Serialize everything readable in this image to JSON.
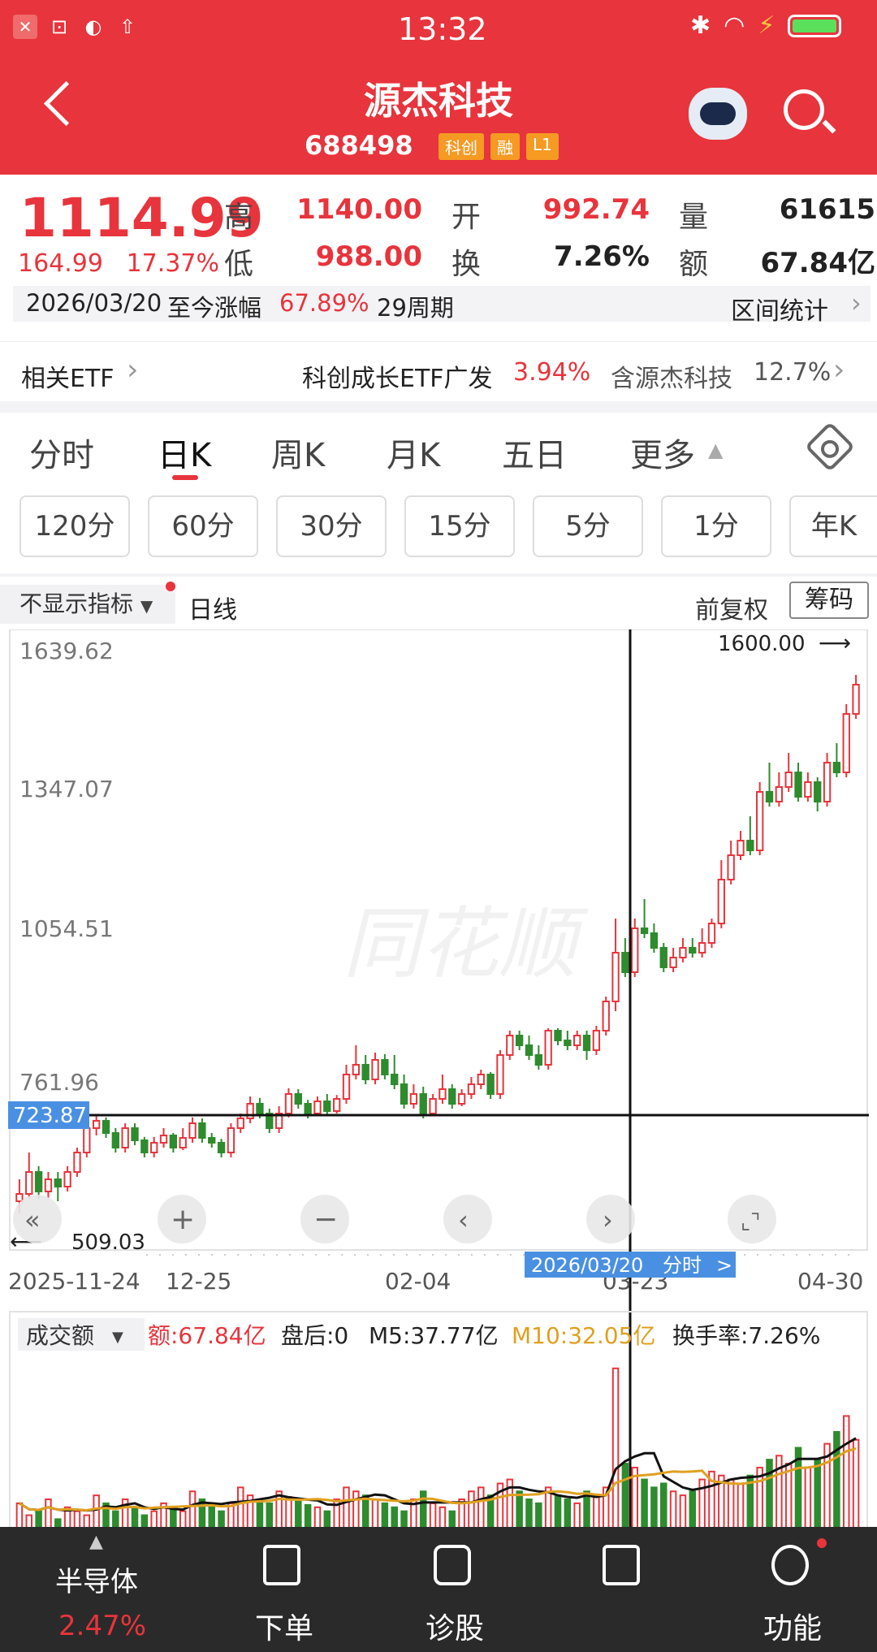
{
  "status_bar": {
    "time": "13:32"
  },
  "header": {
    "title": "源杰科技",
    "code": "688498",
    "tags": [
      "科创",
      "融",
      "L1"
    ]
  },
  "quote": {
    "price": "1114.99",
    "change": "164.99",
    "change_pct": "17.37%",
    "high_label": "高",
    "high": "1140.00",
    "low_label": "低",
    "low": "988.00",
    "open_label": "开",
    "open": "992.74",
    "turnover_label": "换",
    "turnover": "7.26%",
    "volume_label": "量",
    "volume": "61615",
    "amount_label": "额",
    "amount": "67.84亿"
  },
  "range_bar": {
    "date": "2026/03/20",
    "text": "至今涨幅",
    "pct": "67.89%",
    "periods": "29周期",
    "stats_label": "区间统计"
  },
  "etf": {
    "label": "相关ETF",
    "fund": "科创成长ETF广发",
    "fund_pct": "3.94%",
    "contains": "含源杰科技",
    "contains_pct": "12.7%"
  },
  "tabs": [
    "分时",
    "日K",
    "周K",
    "月K",
    "五日",
    "更多"
  ],
  "minute_buttons": [
    "120分",
    "60分",
    "30分",
    "15分",
    "5分",
    "1分",
    "年K"
  ],
  "chart_header": {
    "indicator": "不显示指标",
    "line_type": "日线",
    "adjust": "前复权",
    "chips": "筹码"
  },
  "chart_data": {
    "type": "candlestick",
    "y_ticks": [
      "1639.62",
      "1347.07",
      "1054.51",
      "761.96"
    ],
    "x_ticks": [
      "2025-11-24",
      "12-25",
      "02-04",
      "03-23",
      "04-30"
    ],
    "high_marker": "1600.00",
    "low_marker": "509.03",
    "crosshair_price": "723.87",
    "crosshair_date": "2026/03/20",
    "crosshair_tag": "分时",
    "ylim": [
      480,
      1680
    ],
    "candles": [
      [
        540,
        555,
        515,
        585
      ],
      [
        555,
        600,
        545,
        640
      ],
      [
        600,
        560,
        545,
        612
      ],
      [
        560,
        585,
        545,
        600
      ],
      [
        585,
        570,
        540,
        600
      ],
      [
        570,
        600,
        560,
        612
      ],
      [
        600,
        640,
        590,
        650
      ],
      [
        640,
        690,
        630,
        700
      ],
      [
        690,
        705,
        675,
        715
      ],
      [
        705,
        680,
        670,
        712
      ],
      [
        680,
        650,
        640,
        690
      ],
      [
        650,
        690,
        640,
        700
      ],
      [
        690,
        665,
        655,
        700
      ],
      [
        665,
        640,
        630,
        672
      ],
      [
        640,
        660,
        630,
        672
      ],
      [
        660,
        675,
        650,
        690
      ],
      [
        675,
        650,
        640,
        680
      ],
      [
        650,
        670,
        645,
        690
      ],
      [
        670,
        700,
        660,
        712
      ],
      [
        700,
        670,
        660,
        710
      ],
      [
        670,
        660,
        650,
        680
      ],
      [
        660,
        640,
        630,
        668
      ],
      [
        640,
        690,
        630,
        700
      ],
      [
        690,
        710,
        680,
        720
      ],
      [
        710,
        740,
        700,
        755
      ],
      [
        740,
        720,
        710,
        752
      ],
      [
        720,
        690,
        680,
        730
      ],
      [
        690,
        720,
        680,
        735
      ],
      [
        720,
        760,
        712,
        772
      ],
      [
        760,
        740,
        730,
        770
      ],
      [
        740,
        720,
        710,
        748
      ],
      [
        720,
        745,
        715,
        755
      ],
      [
        745,
        725,
        715,
        760
      ],
      [
        725,
        750,
        720,
        758
      ],
      [
        750,
        800,
        740,
        820
      ],
      [
        800,
        820,
        790,
        860
      ],
      [
        820,
        790,
        780,
        840
      ],
      [
        790,
        830,
        780,
        845
      ],
      [
        830,
        800,
        790,
        842
      ],
      [
        800,
        780,
        770,
        840
      ],
      [
        780,
        740,
        730,
        800
      ],
      [
        740,
        760,
        730,
        780
      ],
      [
        760,
        720,
        710,
        775
      ],
      [
        720,
        750,
        715,
        760
      ],
      [
        750,
        770,
        740,
        800
      ],
      [
        770,
        740,
        730,
        780
      ],
      [
        740,
        760,
        735,
        770
      ],
      [
        760,
        780,
        750,
        795
      ],
      [
        780,
        800,
        770,
        810
      ],
      [
        800,
        760,
        750,
        805
      ],
      [
        760,
        840,
        750,
        850
      ],
      [
        840,
        880,
        830,
        890
      ],
      [
        880,
        860,
        850,
        890
      ],
      [
        860,
        840,
        830,
        880
      ],
      [
        840,
        820,
        810,
        860
      ],
      [
        820,
        890,
        810,
        895
      ],
      [
        890,
        870,
        860,
        895
      ],
      [
        870,
        860,
        850,
        890
      ],
      [
        860,
        880,
        850,
        890
      ],
      [
        880,
        850,
        830,
        890
      ],
      [
        850,
        890,
        840,
        900
      ],
      [
        890,
        950,
        880,
        960
      ],
      [
        950,
        1050,
        930,
        1120
      ],
      [
        1050,
        1010,
        1000,
        1080
      ],
      [
        1010,
        1100,
        1000,
        1120
      ],
      [
        1100,
        1090,
        1080,
        1160
      ],
      [
        1090,
        1060,
        1050,
        1110
      ],
      [
        1060,
        1020,
        1010,
        1070
      ],
      [
        1020,
        1040,
        1010,
        1060
      ],
      [
        1040,
        1060,
        1030,
        1080
      ],
      [
        1060,
        1050,
        1040,
        1080
      ],
      [
        1050,
        1070,
        1040,
        1100
      ],
      [
        1070,
        1110,
        1060,
        1120
      ],
      [
        1110,
        1200,
        1100,
        1240
      ],
      [
        1200,
        1250,
        1190,
        1280
      ],
      [
        1250,
        1280,
        1240,
        1300
      ],
      [
        1280,
        1260,
        1250,
        1330
      ],
      [
        1260,
        1380,
        1250,
        1400
      ],
      [
        1380,
        1360,
        1350,
        1440
      ],
      [
        1360,
        1390,
        1350,
        1420
      ],
      [
        1390,
        1420,
        1380,
        1460
      ],
      [
        1420,
        1370,
        1360,
        1440
      ],
      [
        1370,
        1400,
        1360,
        1420
      ],
      [
        1400,
        1360,
        1340,
        1410
      ],
      [
        1360,
        1440,
        1350,
        1460
      ],
      [
        1440,
        1420,
        1410,
        1480
      ],
      [
        1420,
        1540,
        1410,
        1560
      ],
      [
        1540,
        1600,
        1530,
        1620
      ]
    ]
  },
  "volume_header": {
    "selector": "成交额",
    "amount": "额:67.84亿",
    "after_hours": "盘后:0",
    "m5": "M5:37.77亿",
    "m10": "M10:32.05亿",
    "turnover": "换手率:7.26%"
  },
  "volume_data": [
    40,
    25,
    30,
    45,
    20,
    35,
    30,
    25,
    50,
    40,
    30,
    45,
    35,
    25,
    30,
    40,
    35,
    30,
    55,
    45,
    35,
    30,
    40,
    60,
    50,
    45,
    40,
    55,
    48,
    42,
    38,
    35,
    30,
    45,
    60,
    55,
    50,
    45,
    40,
    35,
    30,
    45,
    55,
    40,
    35,
    30,
    45,
    55,
    60,
    50,
    65,
    70,
    55,
    45,
    40,
    60,
    50,
    45,
    40,
    55,
    50,
    60,
    210,
    90,
    85,
    70,
    60,
    65,
    55,
    50,
    55,
    70,
    80,
    75,
    70,
    65,
    75,
    85,
    95,
    100,
    90,
    110,
    85,
    95,
    115,
    130,
    150,
    120
  ],
  "bottom_nav": {
    "sector_name": "半导体",
    "sector_pct": "2.47%",
    "items": [
      "下单",
      "诊股",
      "功能"
    ]
  }
}
